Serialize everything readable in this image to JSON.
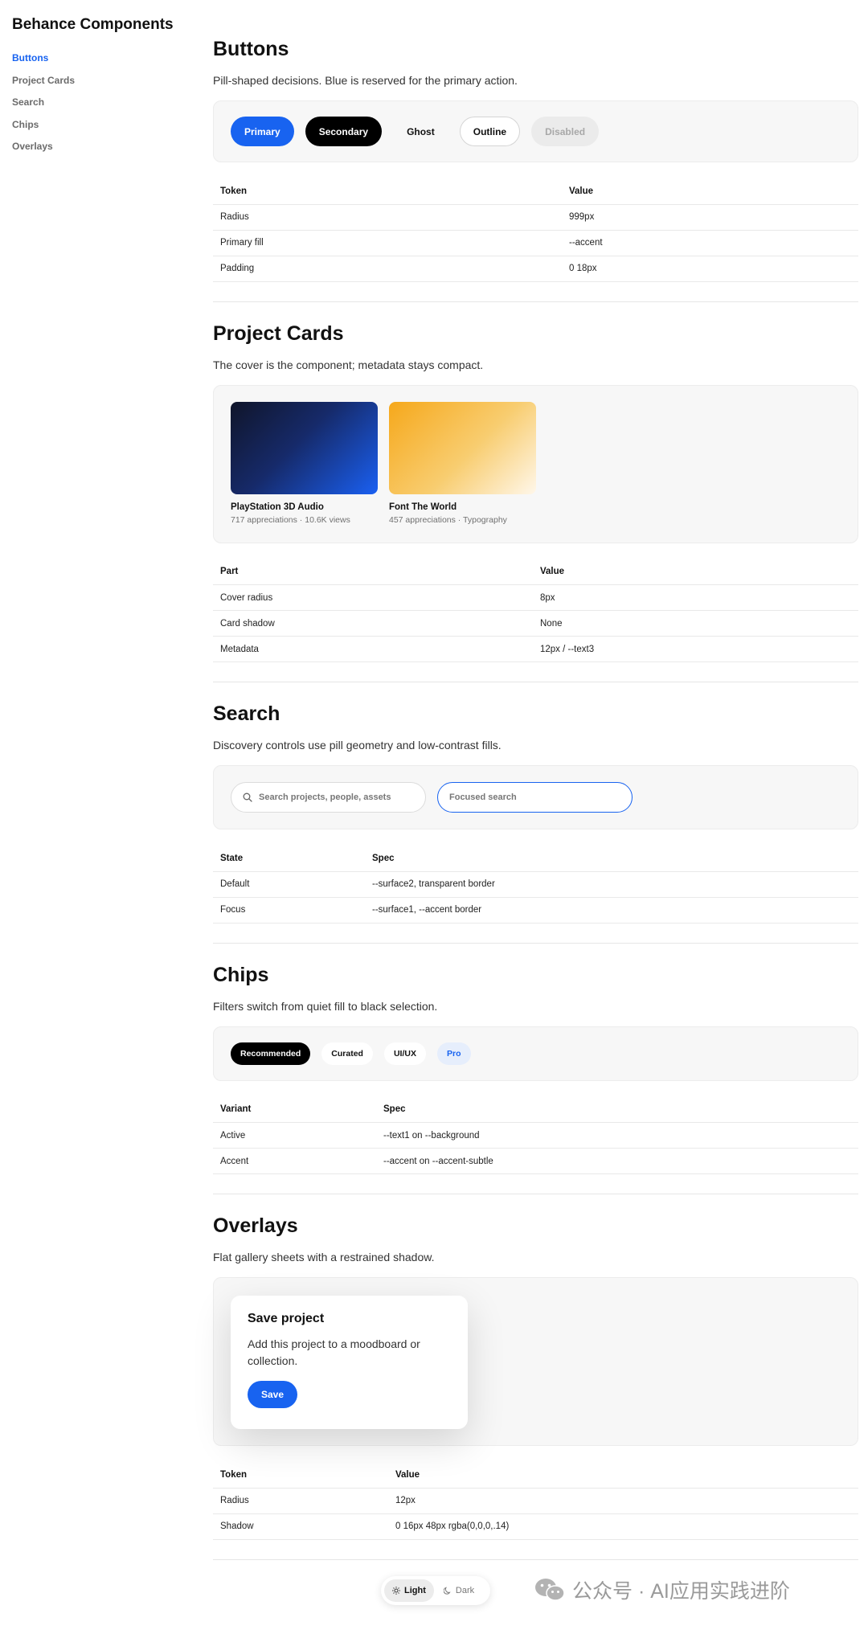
{
  "sidebar": {
    "brand": "Behance Components",
    "items": [
      {
        "label": "Buttons",
        "active": true
      },
      {
        "label": "Project Cards",
        "active": false
      },
      {
        "label": "Search",
        "active": false
      },
      {
        "label": "Chips",
        "active": false
      },
      {
        "label": "Overlays",
        "active": false
      }
    ]
  },
  "buttons": {
    "title": "Buttons",
    "desc": "Pill-shaped decisions. Blue is reserved for the primary action.",
    "labels": {
      "primary": "Primary",
      "secondary": "Secondary",
      "ghost": "Ghost",
      "outline": "Outline",
      "disabled": "Disabled"
    },
    "table": {
      "headers": [
        "Token",
        "Value"
      ],
      "rows": [
        [
          "Radius",
          "999px"
        ],
        [
          "Primary fill",
          "--accent"
        ],
        [
          "Padding",
          "0 18px"
        ]
      ]
    }
  },
  "cards": {
    "title": "Project Cards",
    "desc": "The cover is the component; metadata stays compact.",
    "items": [
      {
        "title": "PlayStation 3D Audio",
        "meta": "717 appreciations · 10.6K views"
      },
      {
        "title": "Font The World",
        "meta": "457 appreciations · Typography"
      }
    ],
    "table": {
      "headers": [
        "Part",
        "Value"
      ],
      "rows": [
        [
          "Cover radius",
          "8px"
        ],
        [
          "Card shadow",
          "None"
        ],
        [
          "Metadata",
          "12px / --text3"
        ]
      ]
    }
  },
  "search": {
    "title": "Search",
    "desc": "Discovery controls use pill geometry and low-contrast fills.",
    "default_placeholder": "Search projects, people, assets",
    "focus_placeholder": "Focused search",
    "table": {
      "headers": [
        "State",
        "Spec"
      ],
      "rows": [
        [
          "Default",
          "--surface2, transparent border"
        ],
        [
          "Focus",
          "--surface1, --accent border"
        ]
      ]
    }
  },
  "chips": {
    "title": "Chips",
    "desc": "Filters switch from quiet fill to black selection.",
    "items": [
      "Recommended",
      "Curated",
      "UI/UX",
      "Pro"
    ],
    "table": {
      "headers": [
        "Variant",
        "Spec"
      ],
      "rows": [
        [
          "Active",
          "--text1 on --background"
        ],
        [
          "Accent",
          "--accent on --accent-subtle"
        ]
      ]
    }
  },
  "overlays": {
    "title": "Overlays",
    "desc": "Flat gallery sheets with a restrained shadow.",
    "sheet_title": "Save project",
    "sheet_body": "Add this project to a moodboard or collection.",
    "sheet_button": "Save",
    "table": {
      "headers": [
        "Token",
        "Value"
      ],
      "rows": [
        [
          "Radius",
          "12px"
        ],
        [
          "Shadow",
          "0 16px 48px rgba(0,0,0,.14)"
        ]
      ]
    }
  },
  "theme": {
    "light": "Light",
    "dark": "Dark",
    "active": "light"
  },
  "watermark": {
    "text": "公众号 · AI应用实践进阶"
  },
  "colors": {
    "accent": "#1863f0",
    "black": "#000000",
    "surface": "#f7f7f7"
  }
}
